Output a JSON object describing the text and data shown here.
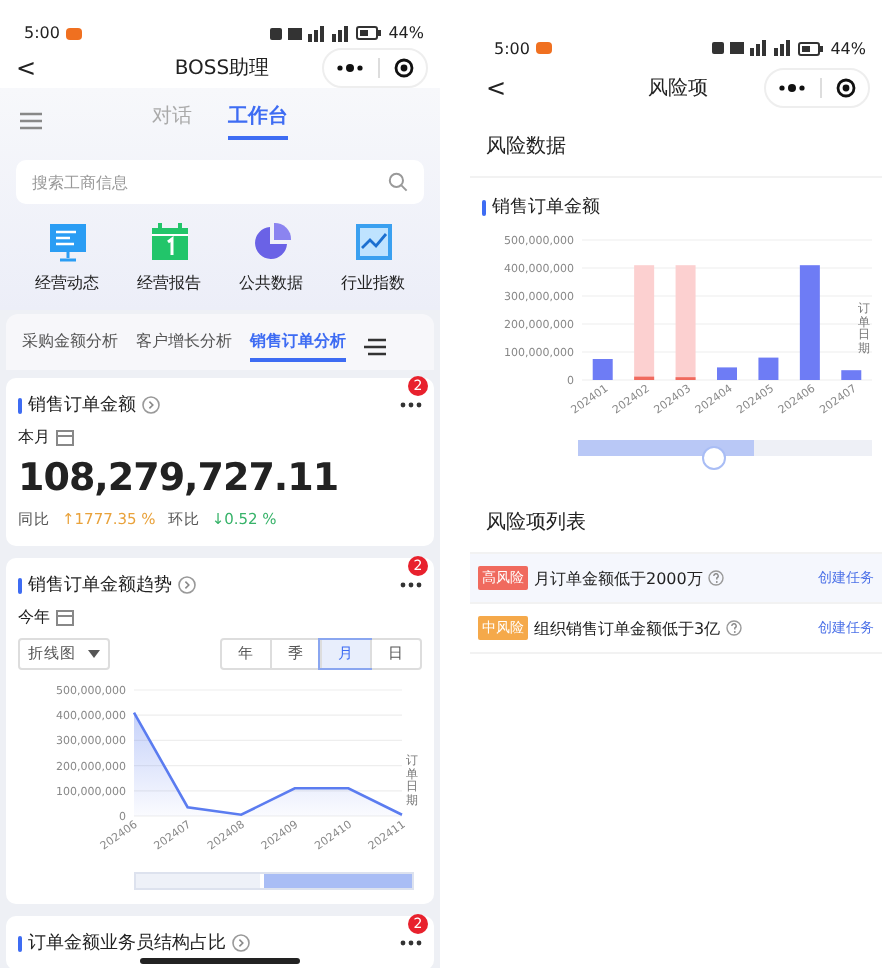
{
  "left": {
    "status_bar": {
      "time": "5:00",
      "battery": "44%"
    },
    "nav": {
      "back": "<",
      "title": "BOSS助理"
    },
    "tabs": [
      {
        "label": "对话",
        "selected": false
      },
      {
        "label": "工作台",
        "selected": true
      }
    ],
    "search": {
      "placeholder": "搜索工商信息"
    },
    "shortcuts": [
      {
        "label": "经营动态",
        "kind": "monitor"
      },
      {
        "label": "经营报告",
        "kind": "calendar"
      },
      {
        "label": "公共数据",
        "kind": "pie"
      },
      {
        "label": "行业指数",
        "kind": "trend"
      }
    ],
    "sub_tabs": [
      {
        "label": "采购金额分析",
        "selected": false
      },
      {
        "label": "客户增长分析",
        "selected": false
      },
      {
        "label": "销售订单分析",
        "selected": true
      }
    ],
    "amount_card": {
      "title": "销售订单金额",
      "badge": "2",
      "period": "本月",
      "value": "108,279,727.11",
      "yoy_label": "同比",
      "yoy": "↑1777.35 %",
      "mom_label": "环比",
      "mom": "↓0.52 %"
    },
    "trend_card": {
      "title": "销售订单金额趋势",
      "badge": "2",
      "period": "今年",
      "chart_type": "折线图",
      "ranges": [
        {
          "label": "年",
          "selected": false
        },
        {
          "label": "季",
          "selected": false
        },
        {
          "label": "月",
          "selected": true
        },
        {
          "label": "日",
          "selected": false
        }
      ],
      "chart_data": {
        "type": "area",
        "ylabel": "订单日期",
        "grid": true,
        "categories": [
          "202406",
          "202407",
          "202408",
          "202409",
          "202410",
          "202411"
        ],
        "series": [
          {
            "color": "#5b7cf0",
            "values": [
              410000000,
              35000000,
              5000000,
              110000000,
              110000000,
              5000000
            ]
          }
        ],
        "ylim": [
          0,
          500000000
        ],
        "yticks": [
          {
            "value": 0,
            "label": "0"
          },
          {
            "value": 100000000,
            "label": "100,000,000"
          },
          {
            "value": 200000000,
            "label": "200,000,000"
          },
          {
            "value": 300000000,
            "label": "300,000,000"
          },
          {
            "value": 400000000,
            "label": "400,000,000"
          },
          {
            "value": 500000000,
            "label": "500,000,000"
          }
        ]
      }
    },
    "structure_card": {
      "title": "订单金额业务员结构占比",
      "badge": "2"
    }
  },
  "right": {
    "status_bar": {
      "time": "5:00",
      "battery": "44%"
    },
    "nav": {
      "back": "<",
      "title": "风险项"
    },
    "section_title": "风险数据",
    "chart_title": "销售订单金额",
    "chart_data": {
      "type": "bar",
      "ylabel": "订单日期",
      "grid": true,
      "categories": [
        "202401",
        "202402",
        "202403",
        "202404",
        "202405",
        "202406",
        "202407"
      ],
      "series": [
        {
          "color": "#fcd0d0",
          "values": [
            null,
            410000000,
            410000000,
            null,
            null,
            null,
            null
          ]
        },
        {
          "color": "#6e7cf5",
          "values": [
            75000000,
            null,
            null,
            45000000,
            80000000,
            410000000,
            35000000
          ]
        },
        {
          "color": "#f06a5e",
          "values": [
            null,
            12000000,
            10000000,
            null,
            null,
            null,
            null
          ]
        }
      ],
      "ylim": [
        0,
        500000000
      ],
      "yticks": [
        {
          "value": 0,
          "label": "0"
        },
        {
          "value": 100000000,
          "label": "100,000,000"
        },
        {
          "value": 200000000,
          "label": "200,000,000"
        },
        {
          "value": 300000000,
          "label": "300,000,000"
        },
        {
          "value": 400000000,
          "label": "400,000,000"
        },
        {
          "value": 500000000,
          "label": "500,000,000"
        }
      ]
    },
    "list_title": "风险项列表",
    "risks": [
      {
        "level": "高风险",
        "color": "#f06a5e",
        "text": "月订单金额低于2000万",
        "action": "创建任务"
      },
      {
        "level": "中风险",
        "color": "#f5a94a",
        "text": "组织销售订单金额低于3亿",
        "action": "创建任务"
      }
    ]
  }
}
